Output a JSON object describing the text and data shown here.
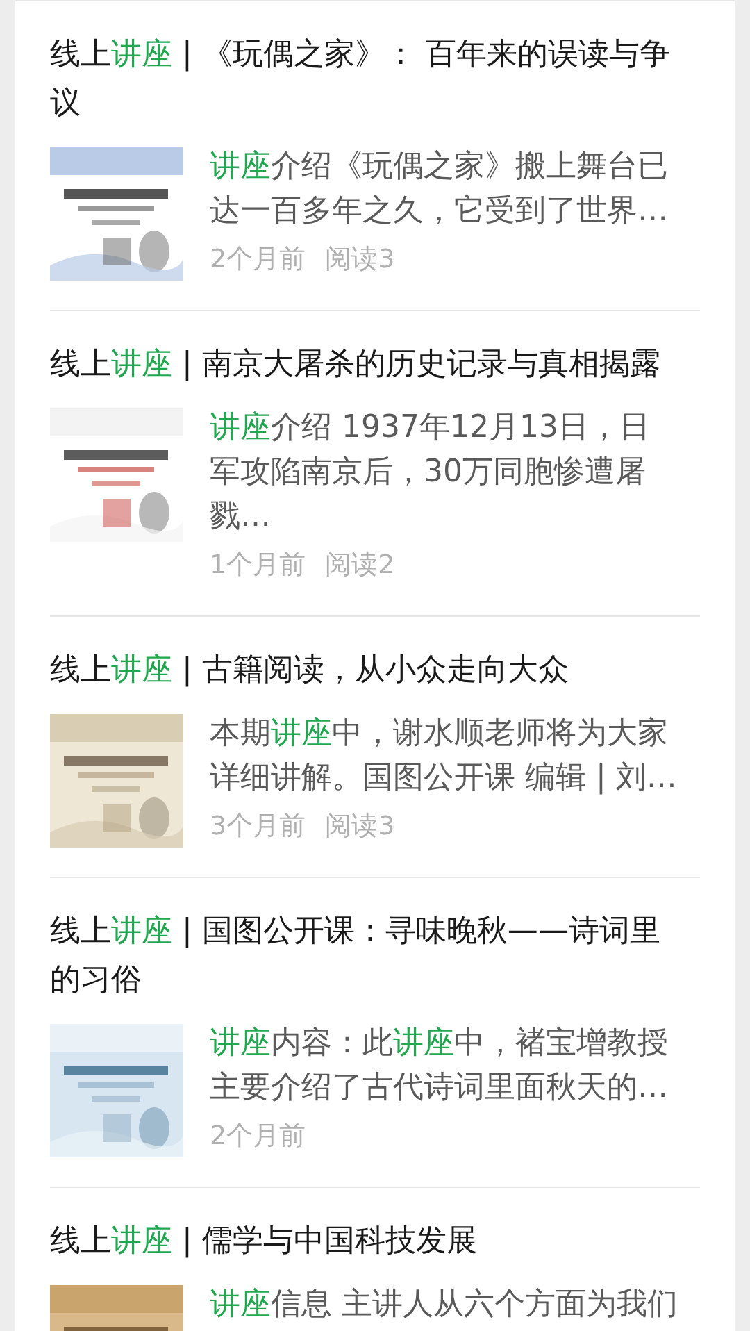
{
  "articles": [
    {
      "title": [
        {
          "text": "线上",
          "highlight": false
        },
        {
          "text": "讲座",
          "highlight": true
        },
        {
          "text": " | 《玩偶之家》： 百年来的误读与争议",
          "highlight": false
        }
      ],
      "thumbnail": {
        "kind": "picture"
      },
      "snippet": [
        {
          "text": "讲座",
          "highlight": true
        },
        {
          "text": "介绍《玩偶之家》搬上舞台已达一百多年之久，它受到了世界…",
          "highlight": false
        }
      ],
      "time": "2个月前",
      "reads": "阅读3"
    },
    {
      "title": [
        {
          "text": "线上",
          "highlight": false
        },
        {
          "text": "讲座",
          "highlight": true
        },
        {
          "text": " | 南京大屠杀的历史记录与真相揭露",
          "highlight": false
        }
      ],
      "thumbnail": {
        "kind": "picture"
      },
      "snippet": [
        {
          "text": "讲座",
          "highlight": true
        },
        {
          "text": "介绍 1937年12月13日，日军攻陷南京后，30万同胞惨遭屠戮…",
          "highlight": false
        }
      ],
      "time": "1个月前",
      "reads": "阅读2"
    },
    {
      "title": [
        {
          "text": "线上",
          "highlight": false
        },
        {
          "text": "讲座",
          "highlight": true
        },
        {
          "text": " | 古籍阅读，从小众走向大众",
          "highlight": false
        }
      ],
      "thumbnail": {
        "kind": "picture"
      },
      "snippet": [
        {
          "text": "本期",
          "highlight": false
        },
        {
          "text": "讲座",
          "highlight": true
        },
        {
          "text": "中，谢水顺老师将为大家详细讲解。国图公开课 编辑 | 刘…",
          "highlight": false
        }
      ],
      "time": "3个月前",
      "reads": "阅读3"
    },
    {
      "title": [
        {
          "text": "线上",
          "highlight": false
        },
        {
          "text": "讲座",
          "highlight": true
        },
        {
          "text": " | 国图公开课：寻味晚秋——诗词里的习俗",
          "highlight": false
        }
      ],
      "thumbnail": {
        "kind": "picture"
      },
      "snippet": [
        {
          "text": "讲座",
          "highlight": true
        },
        {
          "text": "内容：此",
          "highlight": false
        },
        {
          "text": "讲座",
          "highlight": true
        },
        {
          "text": "中，褚宝增教授主要介绍了古代诗词里面秋天的…",
          "highlight": false
        }
      ],
      "time": "2个月前"
    },
    {
      "title": [
        {
          "text": "线上",
          "highlight": false
        },
        {
          "text": "讲座",
          "highlight": true
        },
        {
          "text": " | 儒学与中国科技发展",
          "highlight": false
        }
      ],
      "thumbnail": {
        "kind": "picture"
      },
      "snippet": [
        {
          "text": "讲座",
          "highlight": true
        },
        {
          "text": "信息 主讲人从六个方面为我们",
          "highlight": false
        }
      ]
    }
  ]
}
